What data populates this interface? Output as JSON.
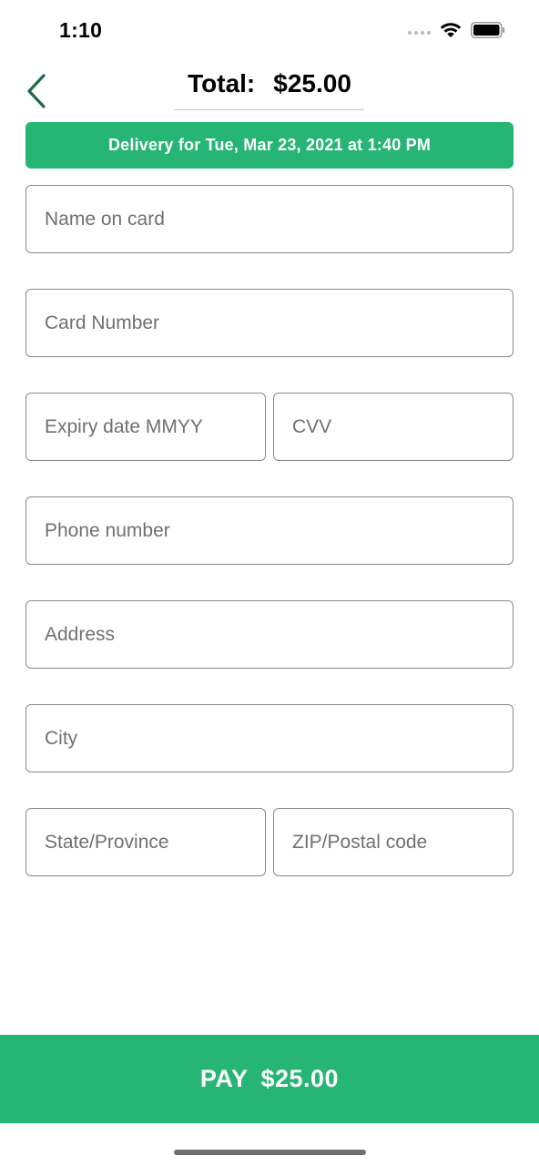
{
  "status_bar": {
    "time": "1:10",
    "icons": [
      "signal-dots-icon",
      "wifi-icon",
      "battery-icon"
    ]
  },
  "header": {
    "back_icon": "chevron-left-icon",
    "total_label": "Total:",
    "total_value": "$25.00"
  },
  "delivery_banner": "Delivery for Tue, Mar 23, 2021 at 1:40 PM",
  "form": {
    "name_on_card": {
      "placeholder": "Name on card",
      "value": ""
    },
    "card_number": {
      "placeholder": "Card Number",
      "value": ""
    },
    "expiry": {
      "placeholder": "Expiry date MMYY",
      "value": ""
    },
    "cvv": {
      "placeholder": "CVV",
      "value": ""
    },
    "phone": {
      "placeholder": "Phone number",
      "value": ""
    },
    "address": {
      "placeholder": "Address",
      "value": ""
    },
    "city": {
      "placeholder": "City",
      "value": ""
    },
    "state": {
      "placeholder": "State/Province",
      "value": ""
    },
    "zip": {
      "placeholder": "ZIP/Postal code",
      "value": ""
    }
  },
  "pay_button": {
    "label": "PAY",
    "amount": "$25.00"
  },
  "colors": {
    "accent": "#26b574",
    "back_chevron": "#1f6b45",
    "field_border": "#8a8a8a",
    "placeholder": "#707070"
  }
}
